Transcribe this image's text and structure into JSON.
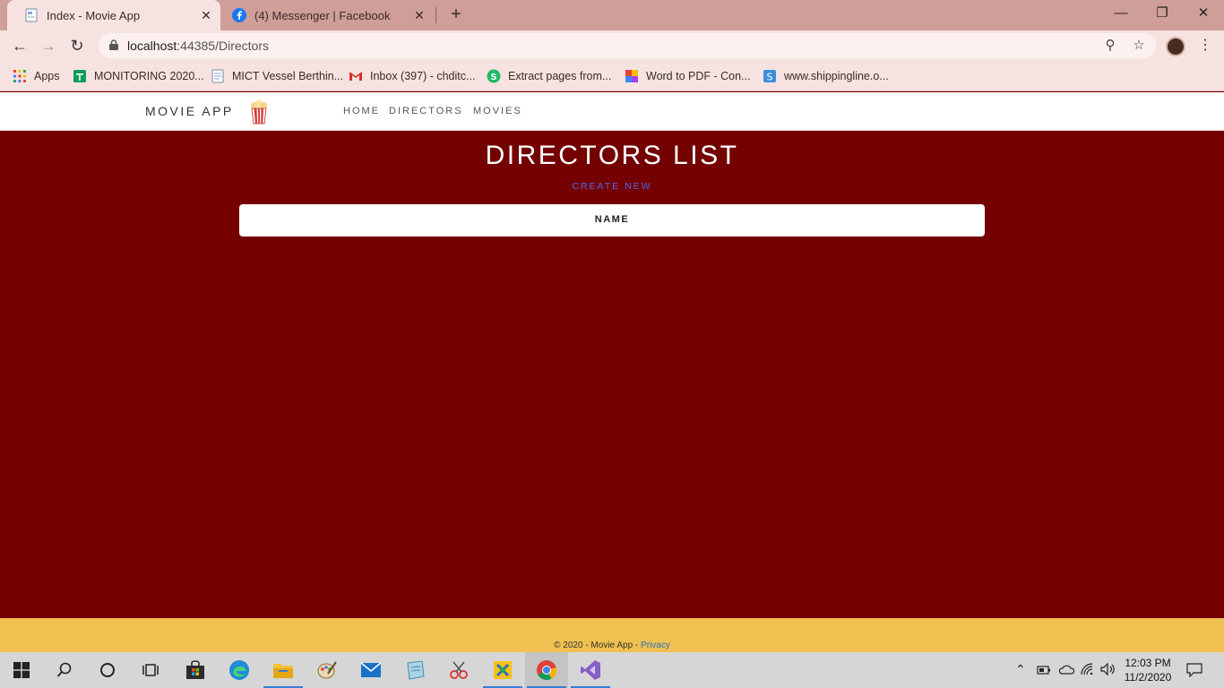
{
  "browser": {
    "tabs": [
      {
        "title": "Index - Movie App",
        "active": true
      },
      {
        "title": "(4) Messenger | Facebook",
        "active": false
      }
    ],
    "url_host": "localhost",
    "url_rest": ":44385/Directors",
    "bookmarks": [
      {
        "label": "Apps"
      },
      {
        "label": "MONITORING 2020..."
      },
      {
        "label": "MICT Vessel Berthin..."
      },
      {
        "label": "Inbox (397) - chditc..."
      },
      {
        "label": "Extract pages from..."
      },
      {
        "label": "Word to PDF - Con..."
      },
      {
        "label": "www.shippingline.o..."
      }
    ]
  },
  "site": {
    "brand": "MOVIE APP",
    "nav": [
      "HOME",
      "DIRECTORS",
      "MOVIES"
    ],
    "title": "DIRECTORS LIST",
    "create_new": "CREATE NEW",
    "table_columns": [
      "NAME"
    ],
    "footer_text": "© 2020 - Movie App - ",
    "footer_link": "Privacy"
  },
  "colors": {
    "page_background": "#740000",
    "footer_background": "#f0c050",
    "link": "#5468e8"
  },
  "taskbar": {
    "time": "12:03 PM",
    "date": "11/2/2020"
  }
}
